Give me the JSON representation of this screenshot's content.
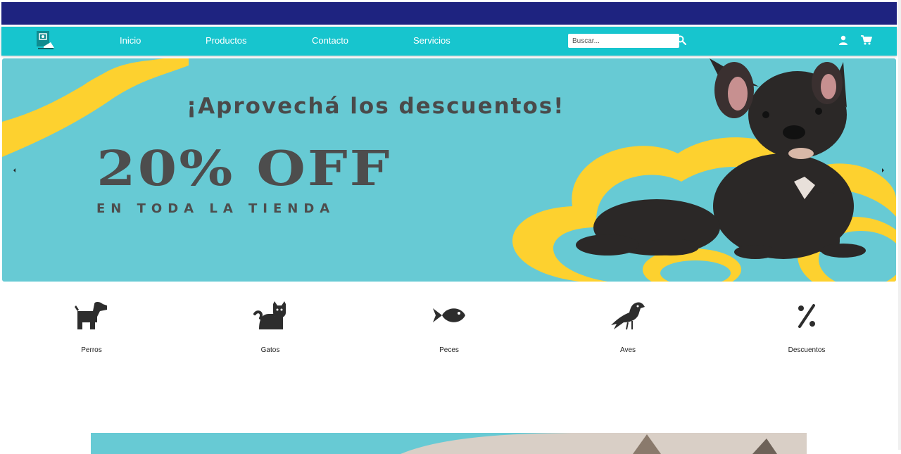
{
  "nav": {
    "links": [
      "Inicio",
      "Productos",
      "Contacto",
      "Servicios"
    ],
    "search_placeholder": "Buscar..."
  },
  "banner": {
    "headline": "¡Aprovechá los descuentos!",
    "offer": "20% OFF",
    "subline": "EN TODA LA TIENDA"
  },
  "categories": [
    "Perros",
    "Gatos",
    "Peces",
    "Aves",
    "Descuentos"
  ],
  "colors": {
    "topbar": "#1e2380",
    "navbar": "#17c5ce",
    "banner_bg": "#67cad4",
    "banner_accent": "#fdd12f",
    "banner_text": "#4d4d4d",
    "icon": "#2d2d2d"
  },
  "icons": [
    "pet-shop-logo-icon",
    "search-icon",
    "user-icon",
    "cart-icon",
    "arrow-left-icon",
    "arrow-right-icon",
    "dog-icon",
    "cat-icon",
    "fish-icon",
    "bird-icon",
    "percent-icon"
  ]
}
